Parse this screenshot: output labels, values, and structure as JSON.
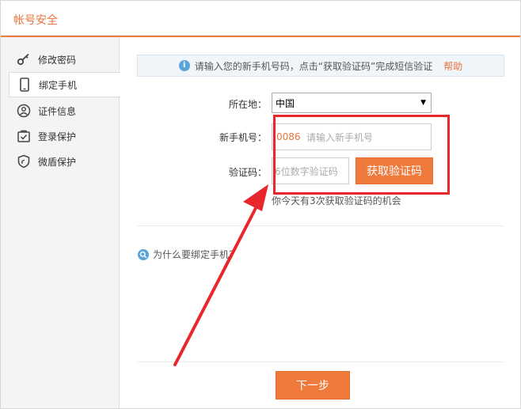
{
  "header": {
    "title": "帐号安全"
  },
  "colors": {
    "accent": "#f0793c",
    "highlight": "#e8262c",
    "info": "#5aa4d8"
  },
  "sidebar": {
    "items": [
      {
        "label": "修改密码",
        "icon": "key-icon",
        "active": false
      },
      {
        "label": "绑定手机",
        "icon": "mobile-phone-icon",
        "active": true
      },
      {
        "label": "证件信息",
        "icon": "id-card-icon",
        "active": false
      },
      {
        "label": "登录保护",
        "icon": "login-protect-icon",
        "active": false
      },
      {
        "label": "微盾保护",
        "icon": "shield-icon",
        "active": false
      }
    ]
  },
  "notice": {
    "text": "请输入您的新手机号码，点击“获取验证码”完成短信验证",
    "help": "帮助"
  },
  "form": {
    "region_label": "所在地：",
    "region_value": "中国",
    "phone_label": "新手机号：",
    "phone_prefix": "0086",
    "phone_placeholder": "请输入新手机号",
    "code_label": "验证码：",
    "code_placeholder": "6位数字验证码",
    "get_code_button": "获取验证码",
    "attempts_text": "你今天有3次获取验证码的机会"
  },
  "why_link": "为什么要绑定手机？",
  "next_button": "下一步"
}
